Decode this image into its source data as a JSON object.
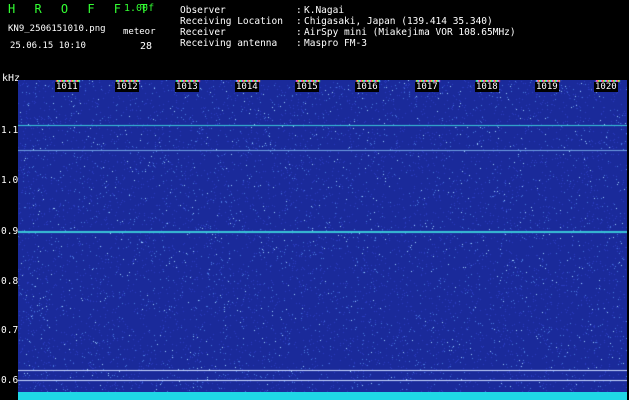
{
  "header": {
    "brand": "H R O F F T",
    "version": "1.00f",
    "filename": "KN9_2506151010.png",
    "meteor_label": "meteor",
    "timestamp": "25.06.15 10:10",
    "meteor_count": "28"
  },
  "info": [
    {
      "label": "Observer",
      "value": "K.Nagai"
    },
    {
      "label": "Receiving Location",
      "value": "Chigasaki, Japan (139.414 35.340)"
    },
    {
      "label": "Receiver",
      "value": "AirSpy mini (Miakejima VOR 108.65MHz)"
    },
    {
      "label": "Receiving antenna",
      "value": "Maspro FM-3"
    }
  ],
  "axis": {
    "y_unit": "kHz",
    "y_ticks": [
      "1.1",
      "1.0",
      "0.9",
      "0.8",
      "0.7",
      "0.6"
    ],
    "x_ticks": [
      "1011",
      "1012",
      "1013",
      "1014",
      "1015",
      "1016",
      "1017",
      "1018",
      "1019",
      "1020"
    ]
  },
  "colors": {
    "background": "#000000",
    "waterfall": "#1a2a9a",
    "label_green": "#33ff33",
    "bottom_bar": "#1fd7e6"
  }
}
